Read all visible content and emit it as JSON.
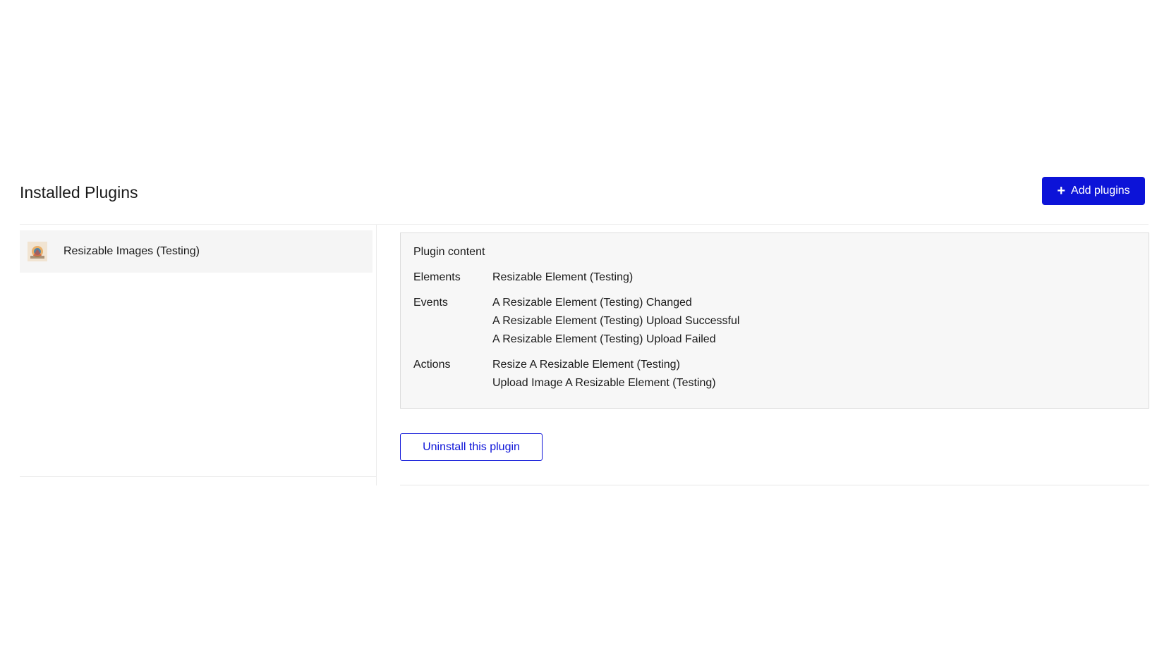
{
  "header": {
    "title": "Installed Plugins",
    "add_button_label": "Add plugins",
    "accent_color": "#0c13d8"
  },
  "plugins": [
    {
      "name": "Resizable Images (Testing)",
      "icon": "plugin-thumbnail-icon",
      "selected": true
    }
  ],
  "plugin_content": {
    "heading": "Plugin content",
    "elements_label": "Elements",
    "elements": [
      "Resizable Element (Testing)"
    ],
    "events_label": "Events",
    "events": [
      "A Resizable Element (Testing) Changed",
      "A Resizable Element (Testing) Upload Successful",
      "A Resizable Element (Testing) Upload Failed"
    ],
    "actions_label": "Actions",
    "actions": [
      "Resize A Resizable Element (Testing)",
      "Upload Image A Resizable Element (Testing)"
    ]
  },
  "uninstall_button_label": "Uninstall this plugin"
}
